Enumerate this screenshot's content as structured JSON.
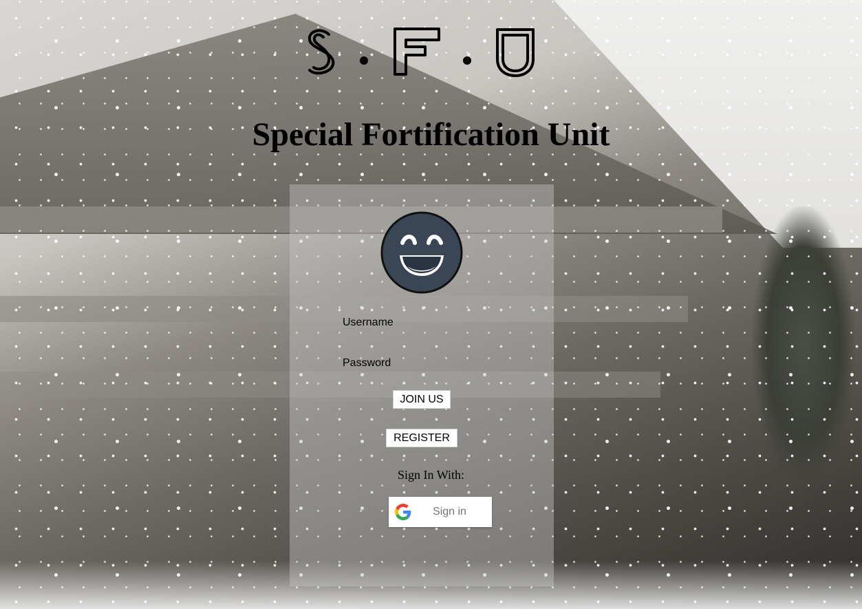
{
  "header": {
    "logo_text": "S.F.U",
    "title": "Special Fortification Unit"
  },
  "login": {
    "avatar_icon": "laughing-face-icon",
    "username_label": "Username",
    "password_label": "Password",
    "join_label": "JOIN US",
    "register_label": "REGISTER",
    "signin_with_label": "Sign In With:",
    "google_button_label": "Sign in",
    "google_icon": "google-g-icon"
  },
  "colors": {
    "avatar_fill": "#3a4556",
    "avatar_face": "#ffffff",
    "panel_overlay": "rgba(200,200,200,0.42)"
  }
}
